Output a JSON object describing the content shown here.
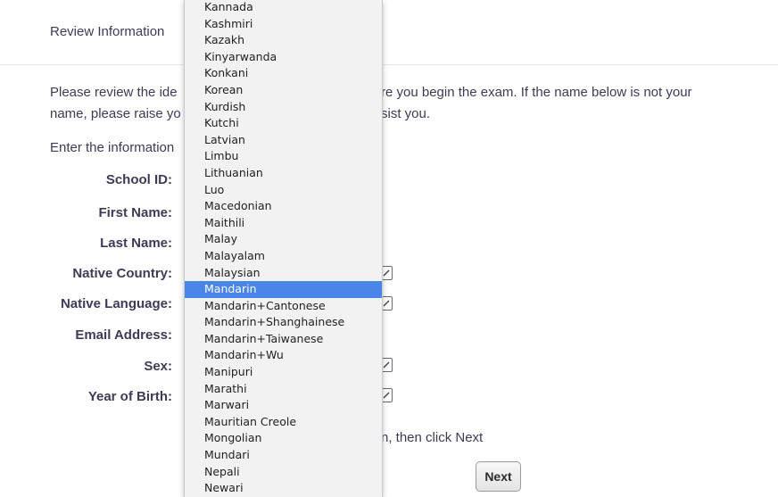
{
  "header": {
    "title": "Review Information"
  },
  "intro": {
    "line1_left": "Please review the ide",
    "line1_right": "re you begin the exam. If the name below is not your",
    "line2_left": "name, please raise yo",
    "line2_right": "sist you.",
    "line3_left": "Enter the information"
  },
  "form": {
    "labels": {
      "school_id": "School ID:",
      "first_name": "First Name:",
      "last_name": "Last Name:",
      "native_country": "Native Country:",
      "native_language": "Native Language:",
      "email": "Email Address:",
      "sex": "Sex:",
      "year_of_birth": "Year of Birth:"
    },
    "footer_text": "n, then click Next",
    "next_label": "Next"
  },
  "language_dropdown": {
    "items": [
      "Kannada",
      "Kashmiri",
      "Kazakh",
      "Kinyarwanda",
      "Konkani",
      "Korean",
      "Kurdish",
      "Kutchi",
      "Latvian",
      "Limbu",
      "Lithuanian",
      "Luo",
      "Macedonian",
      "Maithili",
      "Malay",
      "Malayalam",
      "Malaysian",
      "Mandarin",
      "Mandarin+Cantonese",
      "Mandarin+Shanghainese",
      "Mandarin+Taiwanese",
      "Mandarin+Wu",
      "Manipuri",
      "Marathi",
      "Marwari",
      "Mauritian Creole",
      "Mongolian",
      "Mundari",
      "Nepali",
      "Newari"
    ],
    "selected": "Mandarin",
    "highlight_color": "#4a86e8"
  }
}
